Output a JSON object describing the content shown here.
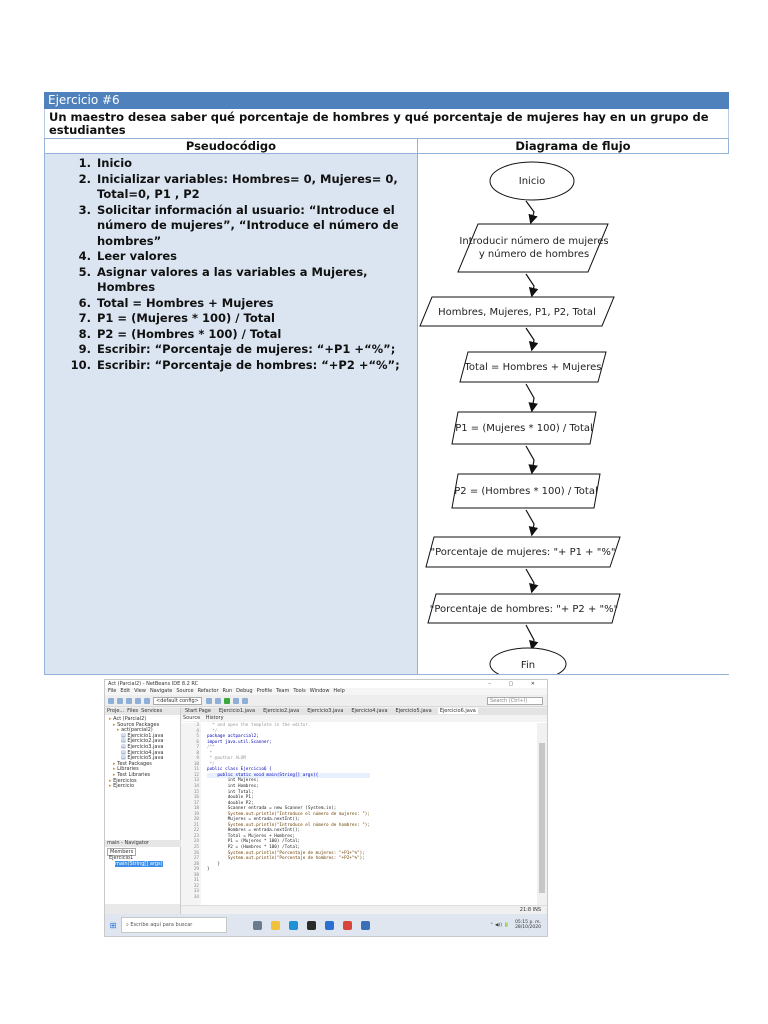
{
  "exercise": {
    "title": "Ejercicio #6",
    "statement": "Un maestro desea saber qué porcentaje de hombres y qué porcentaje de mujeres hay en un grupo de estudiantes",
    "columns": {
      "left": "Pseudocódigo",
      "right": "Diagrama de flujo"
    },
    "steps": [
      {
        "num": "1.",
        "text": "Inicio"
      },
      {
        "num": "2.",
        "text": "Inicializar variables: Hombres= 0, Mujeres= 0, Total=0, P1 , P2"
      },
      {
        "num": "3.",
        "text": "Solicitar información al usuario: “Introduce el número de mujeres”, “Introduce el número de hombres”"
      },
      {
        "num": "4.",
        "text": "Leer valores"
      },
      {
        "num": "5.",
        "text": "Asignar valores a las variables a Mujeres, Hombres"
      },
      {
        "num": "6.",
        "text": "Total = Hombres + Mujeres"
      },
      {
        "num": "7.",
        "text": "P1 = (Mujeres * 100) / Total"
      },
      {
        "num": "8.",
        "text": "P2 = (Hombres * 100) / Total"
      },
      {
        "num": "9.",
        "text": "Escribir: “Porcentaje de mujeres: “+P1 +“%”;"
      },
      {
        "num": "10.",
        "text": "Escribir: “Porcentaje de hombres: “+P2 +“%”;"
      }
    ],
    "flowchart": {
      "start": "Inicio",
      "input_line1": "Introducir número de mujeres",
      "input_line2": "y número de hombres",
      "vars": "Hombres, Mujeres, P1, P2, Total",
      "total": "Total = Hombres + Mujeres",
      "p1": "P1 = (Mujeres * 100) / Total",
      "p2": "P2 = (Hombres * 100) / Total",
      "out1": "\"Porcentaje de mujeres: \"+ P1 + \"%\"",
      "out2": "\"Porcentaje de hombres: \"+ P2 + \"%\"",
      "end": "Fin"
    }
  },
  "ide": {
    "window_title": "Act (Parcial2) - NetBeans IDE 8.2 RC",
    "window_controls": "– ▢ ✕",
    "menu": [
      "File",
      "Edit",
      "View",
      "Navigate",
      "Source",
      "Refactor",
      "Run",
      "Debug",
      "Profile",
      "Team",
      "Tools",
      "Window",
      "Help"
    ],
    "config": "<default config>",
    "search_placeholder": "Search (Ctrl+I)",
    "pane_tabs": [
      "Proje...",
      "Files",
      "Services"
    ],
    "tree": [
      "Act (Parcial2)",
      "Source Packages",
      "act(parcial2)",
      "Ejercicio1.java",
      "Ejercicio2.java",
      "Ejercicio3.java",
      "Ejercicio4.java",
      "Ejercicio5.java",
      "Test Packages",
      "Libraries",
      "Test Libraries",
      "Ejercicios",
      "Ejercicio"
    ],
    "navigator_tab": "main - Navigator",
    "navigator_select": "Members",
    "navigator_items": [
      "Ejercicio1",
      "main(String[] args)"
    ],
    "file_tabs": [
      "Start Page",
      "Ejercicio1.java",
      "Ejercicio2.java",
      "Ejercicio3.java",
      "Ejercicio4.java",
      "Ejercicio5.java",
      "Ejercicio6.java"
    ],
    "editor_tools": [
      "Source",
      "History"
    ],
    "code_lines": [
      "  * and open the template in the editor.",
      "  */",
      "package actparcial2;",
      "import java.util.Scanner;",
      "/**",
      " *",
      " * @author ALUM",
      " */",
      "public class Ejercicio6 {",
      "",
      "    public static void main(String[] args){",
      "",
      "        int Mujeres;",
      "        int Hombres;",
      "        int Total;",
      "        double P1;",
      "        double P2;",
      "",
      "        Scanner entrada = new Scanner (System.in);",
      "",
      "        System.out.println(\"Introduce el número de mujeres: \");",
      "        Mujeres = entrada.nextInt();",
      "        System.out.println(\"Introduce el número de hombres: \");",
      "        Hombres = entrada.nextInt();",
      "        Total = Mujeres + Hombres;",
      "",
      "        P1 = (Mujeres * 100) /Total;",
      "        P2 = (Hombres * 100) /Total;",
      "        System.out.println(\"Porcentaje de mujeres: \"+P1+\"%\");",
      "        System.out.println(\"Porcentaje de hombres: \"+P2+\"%\");",
      "    }",
      "}"
    ],
    "first_line_number": 3,
    "status": "21:8    INS",
    "taskbar_search": "Escribe aquí para buscar",
    "tray_time": "05:15 p. m.",
    "tray_date": "28/10/2020"
  }
}
